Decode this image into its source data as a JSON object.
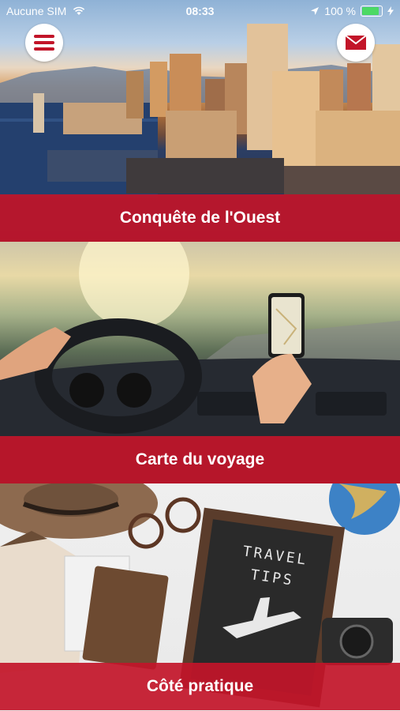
{
  "status_bar": {
    "carrier": "Aucune SIM",
    "time": "08:33",
    "battery": "100 %"
  },
  "sections": [
    {
      "label": "Conquête de l'Ouest"
    },
    {
      "label": "Carte du voyage"
    },
    {
      "label": "Côté pratique"
    }
  ],
  "letter_board": {
    "line1": "TRAVEL",
    "line2": "TIPS"
  },
  "colors": {
    "accent": "#c21529"
  },
  "icons": {
    "menu": "hamburger-icon",
    "mail": "envelope-icon"
  }
}
